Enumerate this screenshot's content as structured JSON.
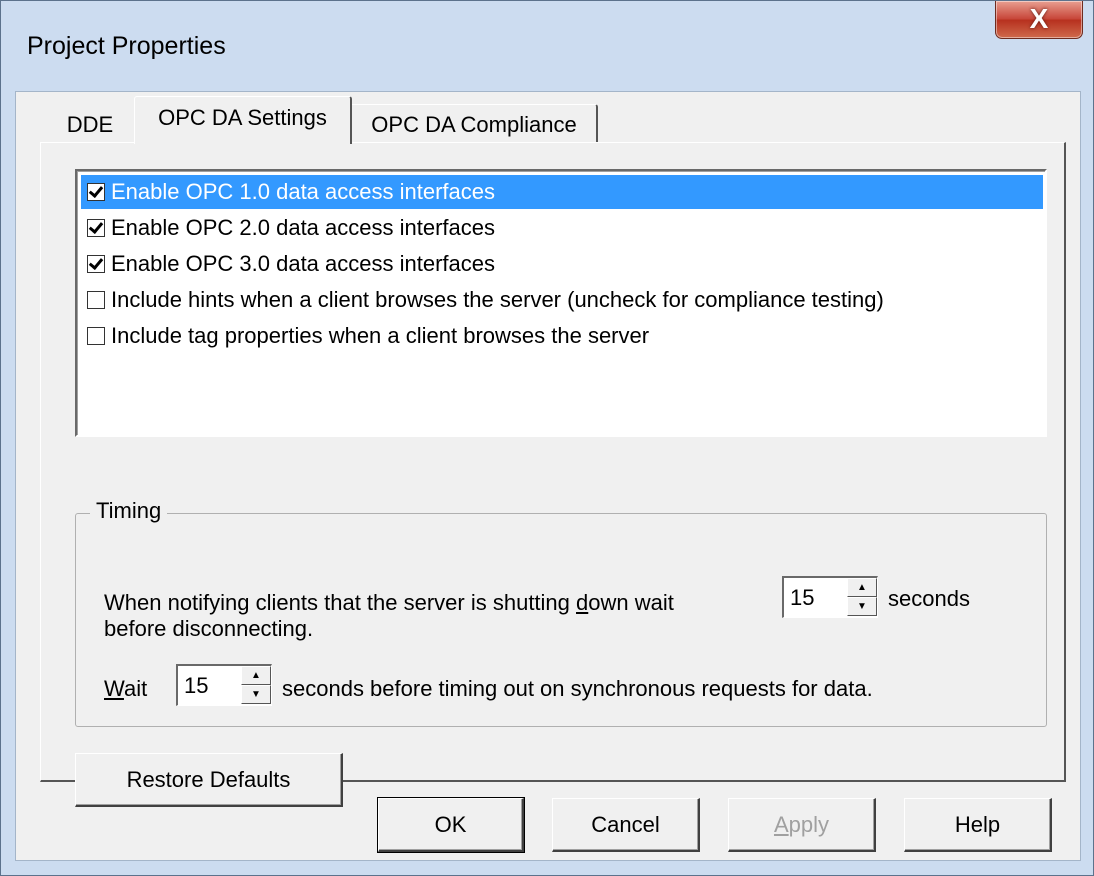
{
  "window": {
    "title": "Project Properties",
    "close_glyph": "X"
  },
  "tabs": [
    {
      "label": "DDE",
      "selected": false
    },
    {
      "label": "OPC DA Settings",
      "selected": true
    },
    {
      "label": "OPC DA Compliance",
      "selected": false
    }
  ],
  "options": [
    {
      "label": "Enable OPC 1.0 data access interfaces",
      "checked": true,
      "selected": true
    },
    {
      "label": "Enable OPC 2.0 data access interfaces",
      "checked": true,
      "selected": false
    },
    {
      "label": "Enable OPC 3.0 data access interfaces",
      "checked": true,
      "selected": false
    },
    {
      "label": "Include hints when a client browses the server (uncheck for compliance testing)",
      "checked": false,
      "selected": false
    },
    {
      "label": "Include tag properties when a client browses the server",
      "checked": false,
      "selected": false
    }
  ],
  "timing": {
    "group_label": "Timing",
    "shutdown_text_a": "When notifying clients that the server is shutting ",
    "shutdown_text_u": "d",
    "shutdown_text_b": "own wait",
    "shutdown_text_line2": "before disconnecting.",
    "shutdown_value": "15",
    "shutdown_unit": "seconds",
    "wait_label_u": "W",
    "wait_label_rest": "ait",
    "wait_value": "15",
    "wait_text": "seconds before timing out on synchronous requests for data."
  },
  "buttons": {
    "restore_defaults": "Restore Defaults",
    "ok": "OK",
    "cancel": "Cancel",
    "apply_u": "A",
    "apply_rest": "pply",
    "help": "Help"
  },
  "spin_glyphs": {
    "up": "▲",
    "down": "▼"
  }
}
